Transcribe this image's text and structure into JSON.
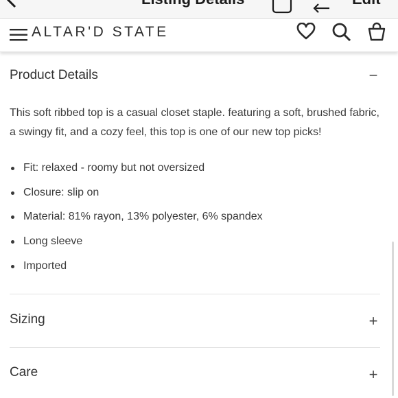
{
  "nav": {
    "title": "Listing Details",
    "edit_label": "Edit"
  },
  "store": {
    "brand": "ALTAR'D STATE"
  },
  "product_details": {
    "title": "Product Details",
    "toggle": "−",
    "description": "This soft ribbed top is a casual closet staple. featuring a soft, brushed fabric, a swingy fit, and a cozy feel, this top is one of our new top picks!",
    "bullets": [
      "Fit: relaxed - roomy but not oversized",
      "Closure: slip on",
      "Material: 81% rayon, 13% polyester, 6% spandex",
      "Long sleeve",
      "Imported"
    ]
  },
  "sizing": {
    "title": "Sizing",
    "toggle": "+"
  },
  "care": {
    "title": "Care",
    "toggle": "+"
  }
}
